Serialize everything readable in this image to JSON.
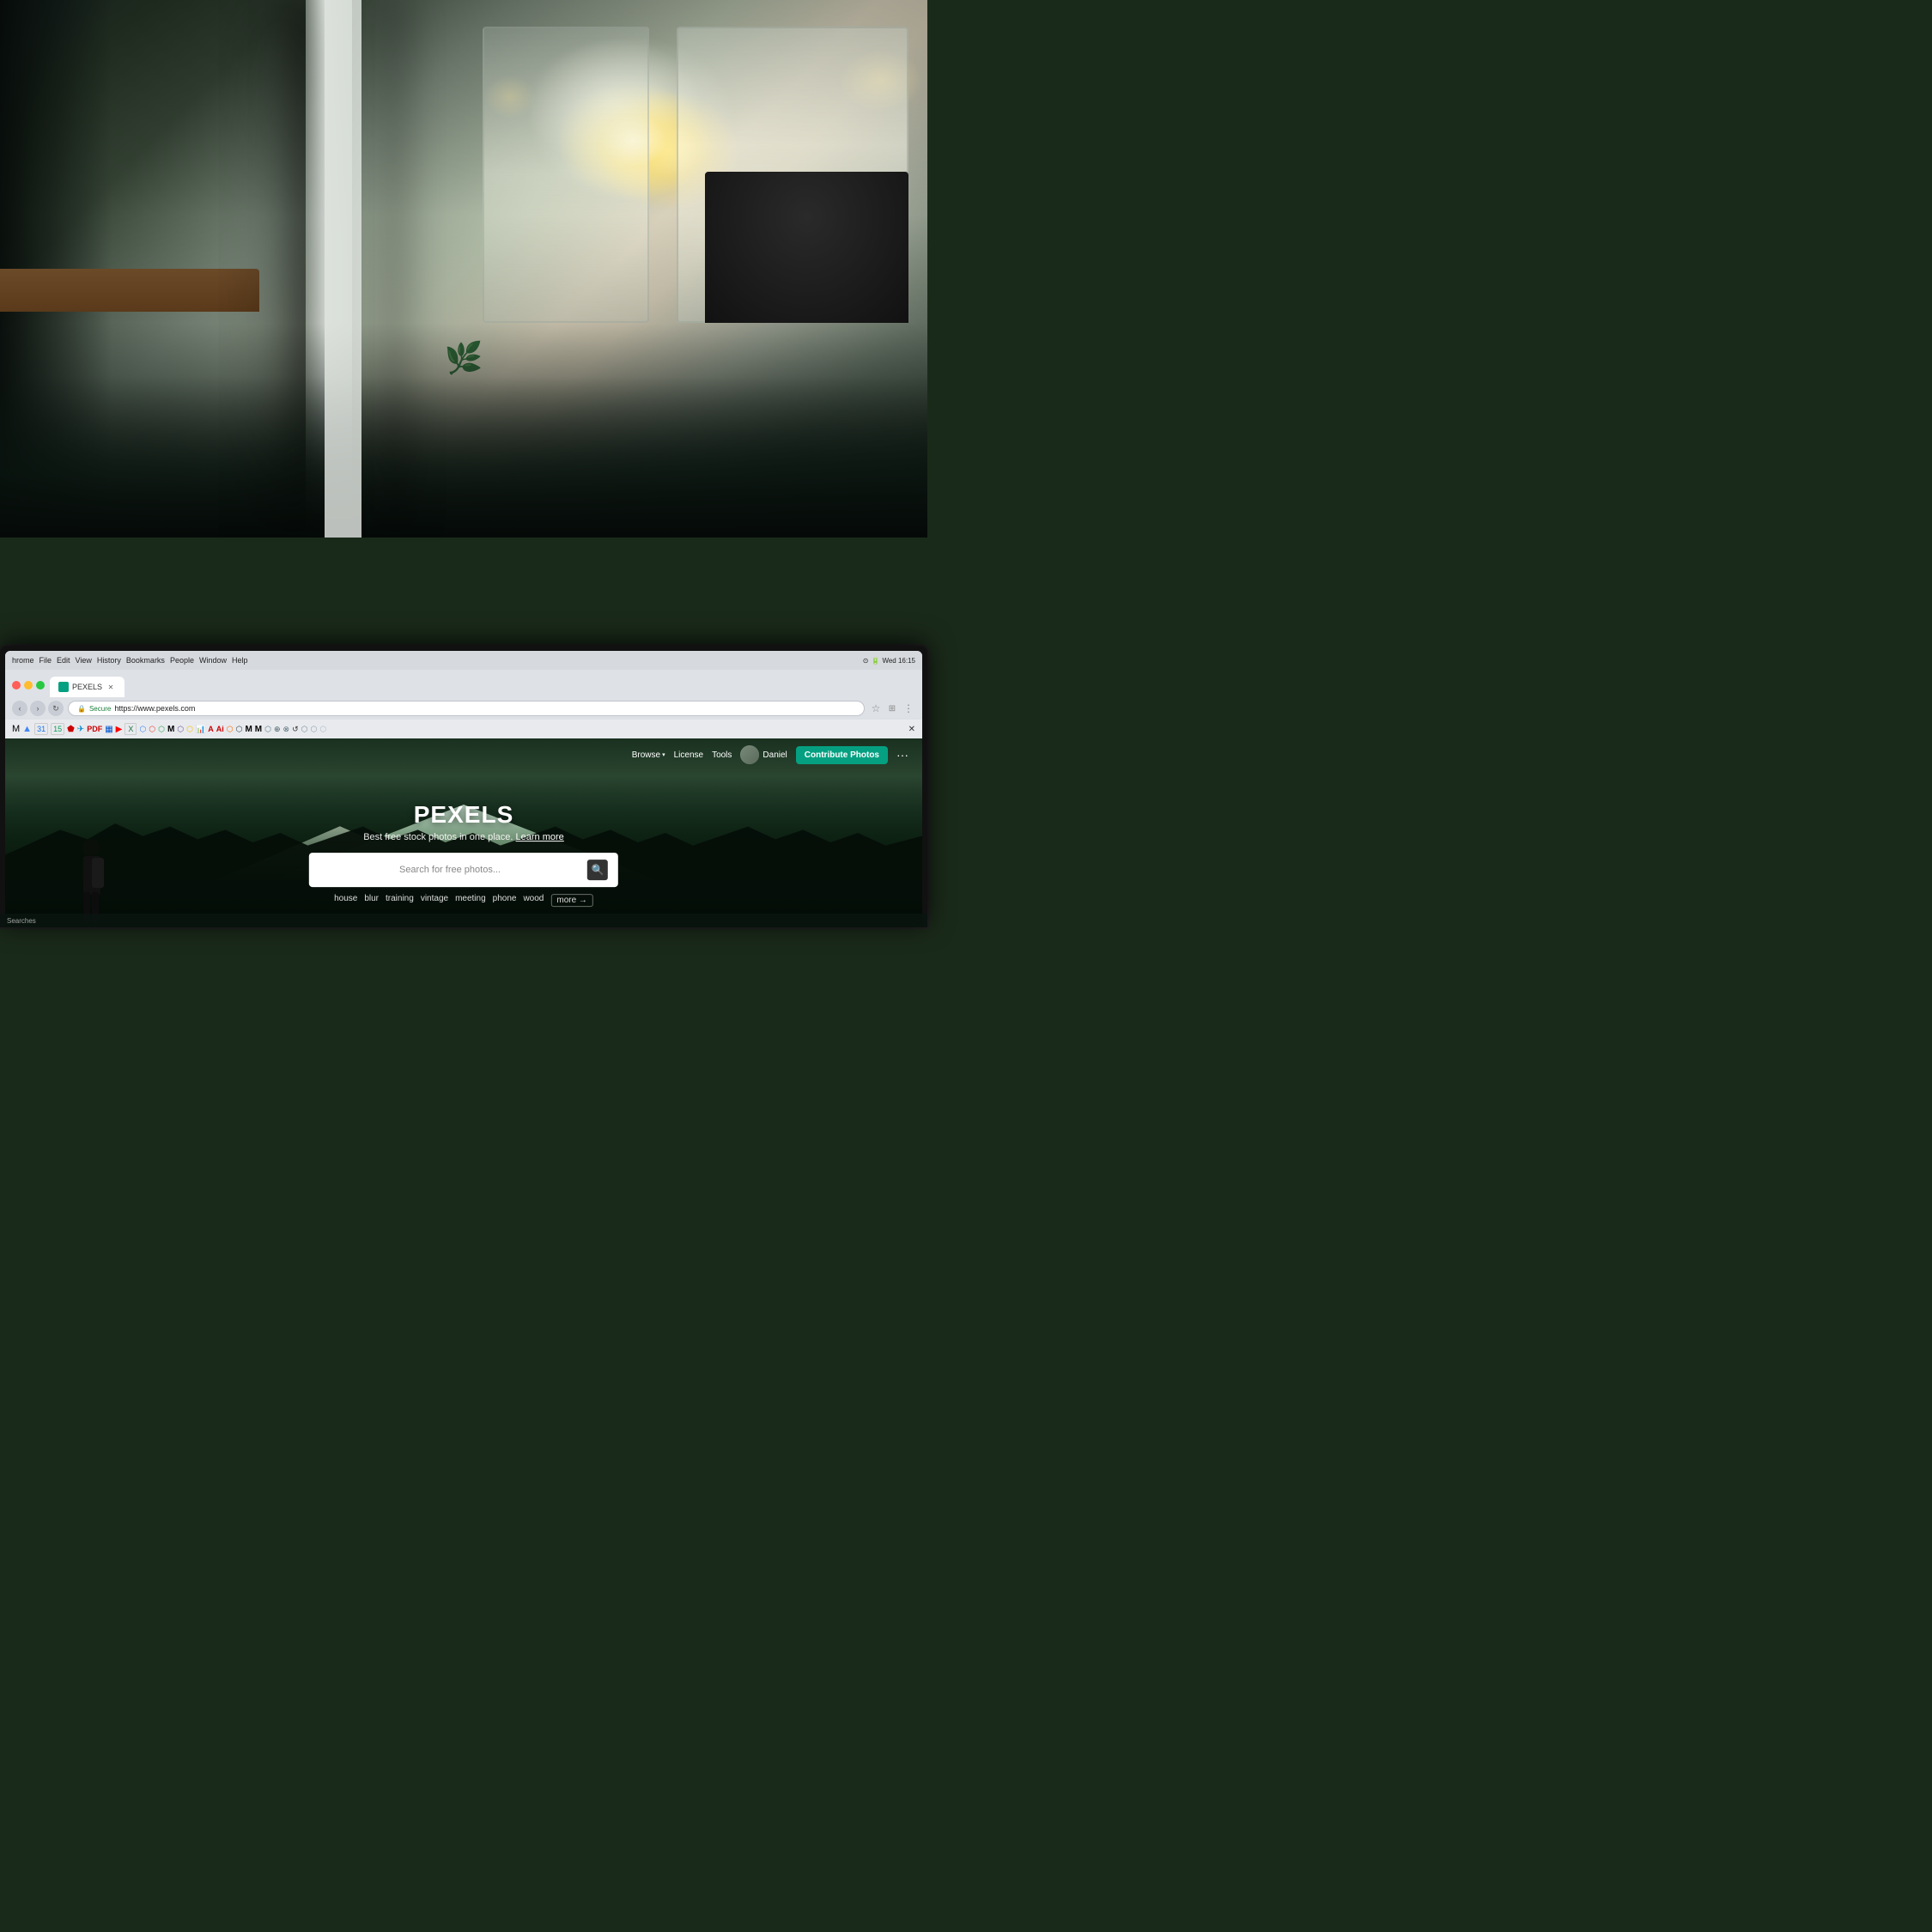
{
  "background": {
    "description": "Office interior with bokeh background, plants, desk, chairs, large windows with light"
  },
  "system_bar": {
    "menu_items": [
      "hrome",
      "File",
      "Edit",
      "View",
      "History",
      "Bookmarks",
      "People",
      "Window",
      "Help"
    ],
    "time": "Wed 16:15",
    "battery": "100%"
  },
  "browser": {
    "tab_label": "Pexels",
    "address": "https://www.pexels.com",
    "secure_label": "Secure"
  },
  "pexels": {
    "nav": {
      "browse_label": "Browse",
      "license_label": "License",
      "tools_label": "Tools",
      "user_label": "Daniel",
      "contribute_label": "Contribute Photos",
      "more_label": "···"
    },
    "hero": {
      "title": "PEXELS",
      "subtitle": "Best free stock photos in one place.",
      "learn_more": "Learn more",
      "search_placeholder": "Search for free photos...",
      "tags": [
        "house",
        "blur",
        "training",
        "vintage",
        "meeting",
        "phone",
        "wood"
      ],
      "more_tag": "more →"
    }
  },
  "status_bar": {
    "text": "Searches"
  }
}
